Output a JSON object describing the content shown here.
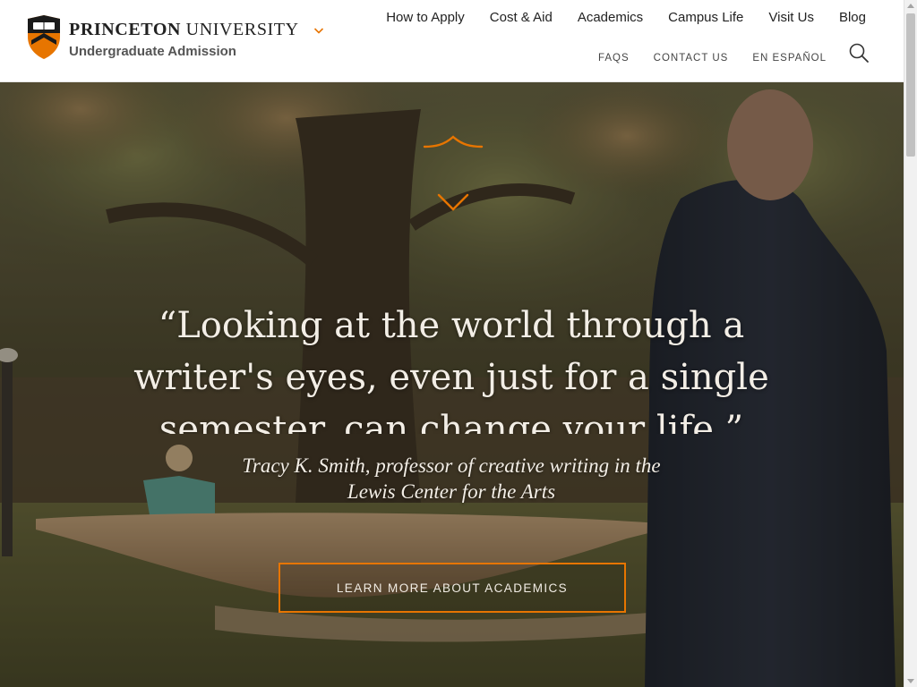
{
  "header": {
    "logo": {
      "wordmark_bold": "PRINCETON",
      "wordmark_regular": "UNIVERSITY",
      "unit_name": "Undergraduate Admission",
      "shield_icon": "princeton-shield-icon",
      "dropdown_icon": "chevron-down-icon"
    },
    "primary_nav": [
      {
        "label": "How to Apply"
      },
      {
        "label": "Cost & Aid"
      },
      {
        "label": "Academics"
      },
      {
        "label": "Campus Life"
      },
      {
        "label": "Visit Us"
      },
      {
        "label": "Blog"
      }
    ],
    "utility_nav": [
      {
        "label": "FAQS"
      },
      {
        "label": "CONTACT US"
      },
      {
        "label": "EN ESPAÑOL"
      }
    ],
    "search_icon": "search-icon"
  },
  "hero": {
    "ornament_icon": "orange-ornament-icon",
    "quote": "“Looking at the world through a writer's eyes, even just for a single semester, can change your life.”",
    "attribution_line1": "Tracy K. Smith, professor of creative writing in the",
    "attribution_line2": "Lewis Center for the Arts",
    "cta_label": "LEARN MORE ABOUT ACADEMICS"
  },
  "colors": {
    "accent_orange": "#e77500",
    "text_dark": "#222222",
    "text_muted": "#555555",
    "hero_text": "#f3eee6"
  }
}
